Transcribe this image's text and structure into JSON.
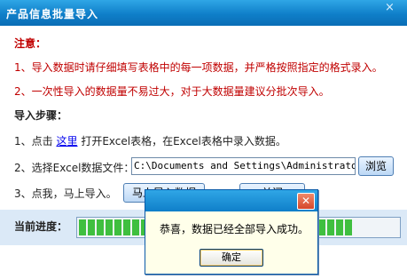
{
  "window": {
    "title": "产品信息批量导入",
    "close_glyph": "×"
  },
  "notice": {
    "heading": "注意：",
    "item1": "1、导入数据时请仔细填写表格中的每一项数据，并严格按照指定的格式录入。",
    "item2": "2、一次性导入的数据量不易过大，对于大数据量建议分批次导入。"
  },
  "steps": {
    "heading": "导入步骤：",
    "step1_prefix": "1、点击",
    "step1_link": "这里",
    "step1_suffix": "打开Excel表格，在Excel表格中录入数据。",
    "step2_label": "2、选择Excel数据文件：",
    "step2_path": "C:\\Documents and Settings\\Administrator\\桌",
    "browse_label": "浏览",
    "step3_label": "3、点我，马上导入。",
    "import_button_partial": "马上导入数据",
    "second_button_partial": "关闭"
  },
  "progress": {
    "label": "当前进度：",
    "value_fraction": 0.86
  },
  "dialog": {
    "message": "恭喜，数据已经全部导入成功。",
    "ok_label": "确定",
    "close_glyph": "✕"
  },
  "colors": {
    "titlebar": "#0f7fc9",
    "notice_red": "#c00000",
    "progress_green": "#3fbf3f",
    "dialog_bg": "#ffffea"
  }
}
